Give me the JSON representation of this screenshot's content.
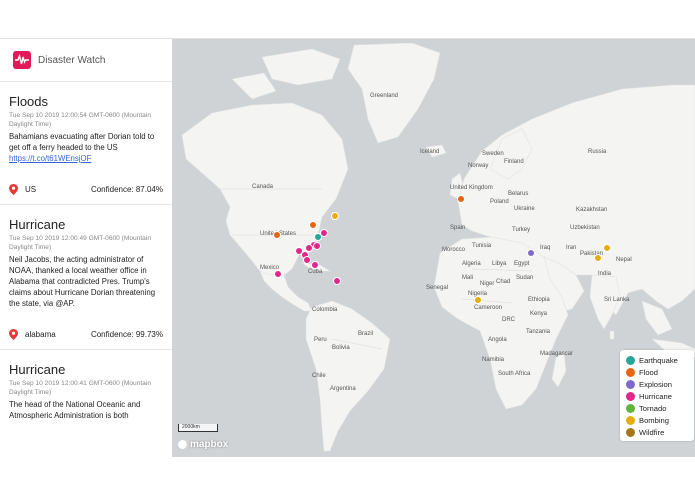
{
  "app": {
    "title": "Disaster Watch"
  },
  "cards": [
    {
      "title": "Floods",
      "timestamp": "Tue Sep 10 2019 12:00:54 GMT-0600 (Mountain Daylight Time)",
      "message": "Bahamians evacuating after Dorian told to get off a ferry headed to the US",
      "link": "https://t.co/t61WEnsjOF",
      "location": "US",
      "confidence": "Confidence: 87.04%"
    },
    {
      "title": "Hurricane",
      "timestamp": "Tue Sep 10 2019 12:00:49 GMT-0600 (Mountain Daylight Time)",
      "message": "Neil Jacobs, the acting administrator of NOAA, thanked a local weather office in Alabama that contradicted Pres. Trump's claims about Hurricane Dorian threatening the state, via @AP.",
      "location": "alabama",
      "confidence": "Confidence: 99.73%"
    },
    {
      "title": "Hurricane",
      "timestamp": "Tue Sep 10 2019 12:00:41 GMT-0600 (Mountain Daylight Time)",
      "message": "The head of the National Oceanic and Atmospheric Administration is both"
    }
  ],
  "map": {
    "labels": [
      "Greenland",
      "Iceland",
      "Canada",
      "United States",
      "Mexico",
      "Cuba",
      "Colombia",
      "Peru",
      "Brazil",
      "Bolivia",
      "Chile",
      "Argentina",
      "Sweden",
      "Finland",
      "Norway",
      "United Kingdom",
      "Belarus",
      "Ukraine",
      "Poland",
      "Kazakhstan",
      "Russia",
      "Spain",
      "Turkey",
      "Iraq",
      "Iran",
      "Uzbekistan",
      "Tunisia",
      "Morocco",
      "Algeria",
      "Libya",
      "Egypt",
      "Mali",
      "Niger",
      "Chad",
      "Sudan",
      "Senegal",
      "Nigeria",
      "Ethiopia",
      "Cameroon",
      "Kenya",
      "DRC",
      "Angola",
      "Tanzania",
      "Namibia",
      "South Africa",
      "Madagascar",
      "Pakistan",
      "India",
      "Nepal",
      "Sri Lanka"
    ],
    "scale": "2000km",
    "attribution": "mapbox"
  },
  "legend": [
    {
      "label": "Earthquake",
      "color": "#26a69a"
    },
    {
      "label": "Flood",
      "color": "#e8650f"
    },
    {
      "label": "Explosion",
      "color": "#7e6bc9"
    },
    {
      "label": "Hurricane",
      "color": "#e2278a"
    },
    {
      "label": "Tornado",
      "color": "#62b43a"
    },
    {
      "label": "Bombing",
      "color": "#e6ad12"
    },
    {
      "label": "Wildfire",
      "color": "#a8761a"
    }
  ]
}
